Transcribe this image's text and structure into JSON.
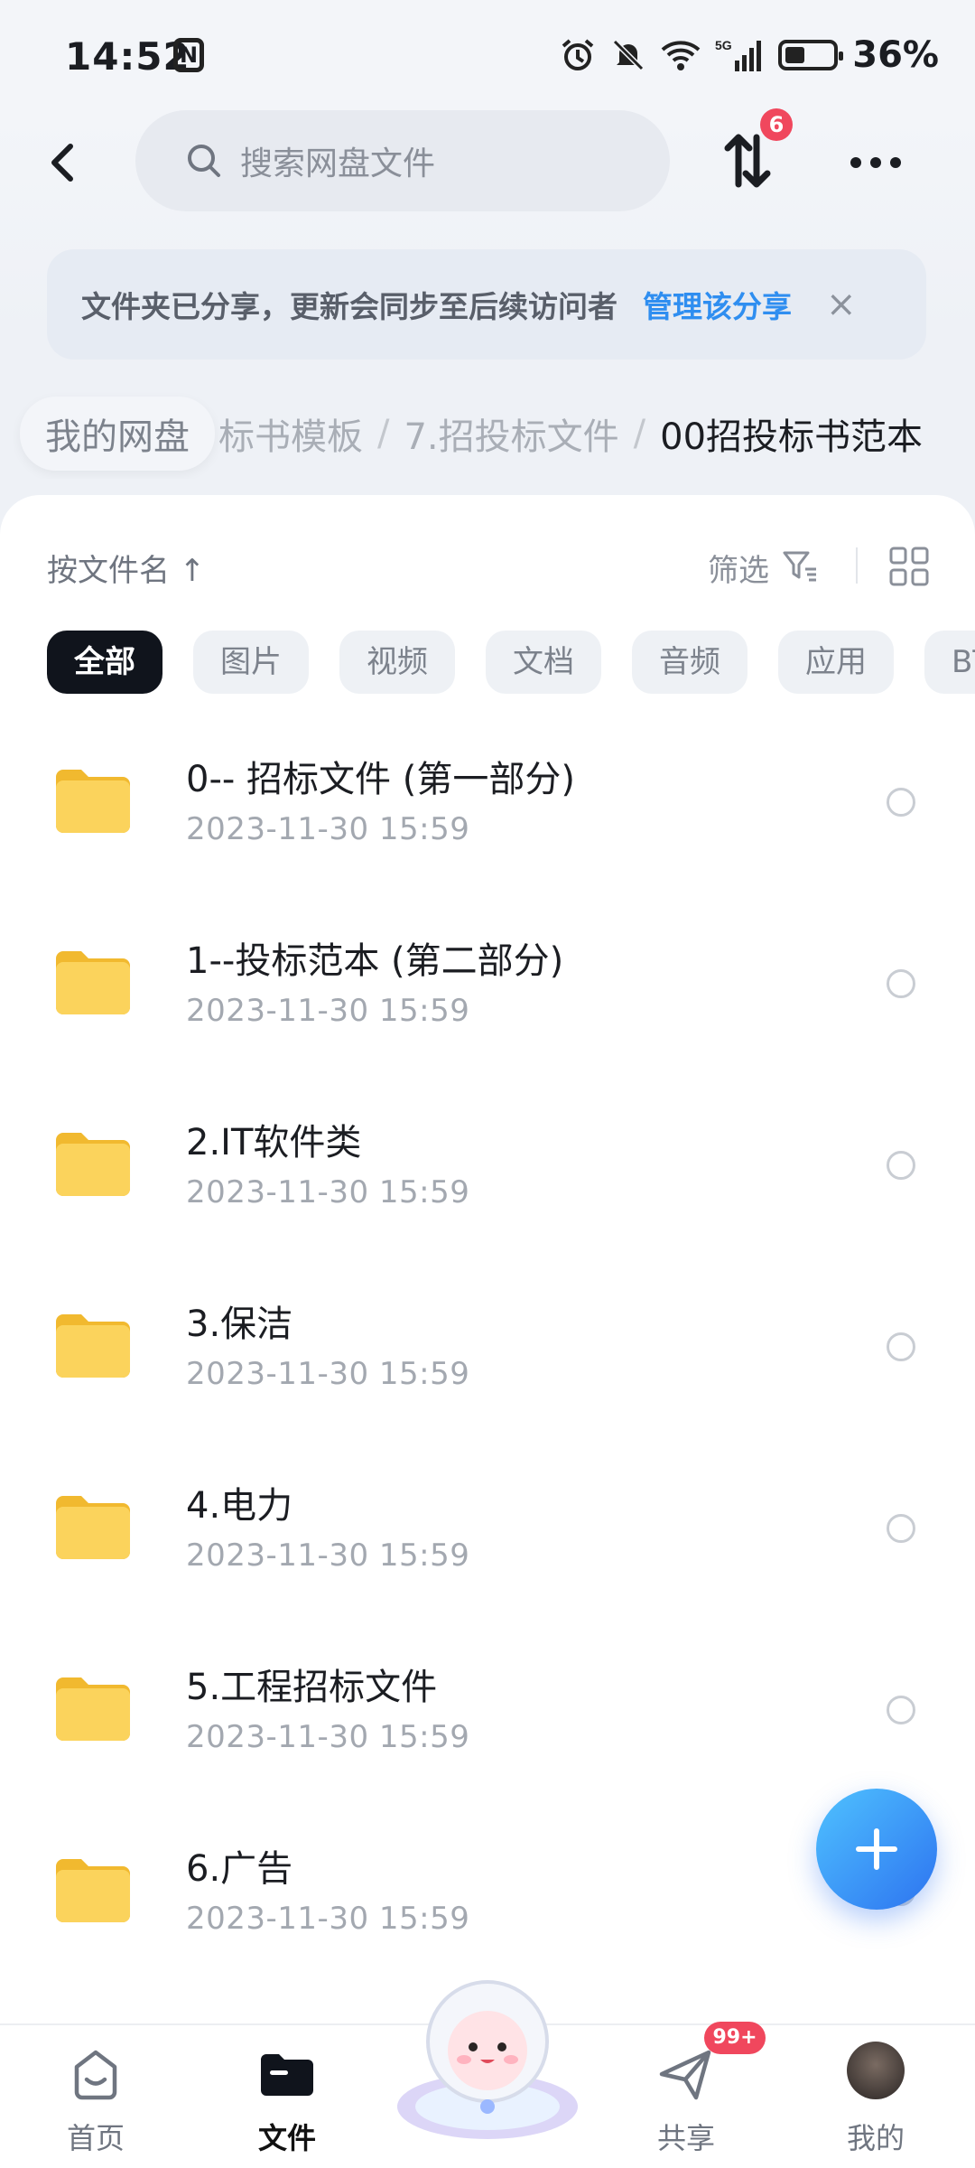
{
  "status_bar": {
    "time": "14:52",
    "network": "5G",
    "battery": "36%",
    "battery_level": 0.36
  },
  "header": {
    "search_placeholder": "搜索网盘文件",
    "transfer_badge": "6"
  },
  "banner": {
    "message": "文件夹已分享，更新会同步至后续访问者",
    "link": "管理该分享",
    "close": "×"
  },
  "breadcrumb": {
    "root": "我的网盘",
    "items": [
      "标书模板",
      "7.招投标文件"
    ],
    "current": "00招投标书范本",
    "separator": "/"
  },
  "toolbar": {
    "sort": "按文件名 ↑",
    "filter": "筛选"
  },
  "chips": [
    "全部",
    "图片",
    "视频",
    "文档",
    "音频",
    "应用",
    "BT"
  ],
  "files": [
    {
      "name": "0-- 招标文件 (第一部分)",
      "date": "2023-11-30  15:59"
    },
    {
      "name": "1--投标范本 (第二部分)",
      "date": "2023-11-30  15:59"
    },
    {
      "name": "2.IT软件类",
      "date": "2023-11-30  15:59"
    },
    {
      "name": "3.保洁",
      "date": "2023-11-30  15:59"
    },
    {
      "name": "4.电力",
      "date": "2023-11-30  15:59"
    },
    {
      "name": "5.工程招标文件",
      "date": "2023-11-30  15:59"
    },
    {
      "name": "6.广告",
      "date": "2023-11-30  15:59"
    }
  ],
  "nav": {
    "home": "首页",
    "files": "文件",
    "share": "共享",
    "share_badge": "99+",
    "me": "我的"
  },
  "colors": {
    "accent": "#2f8ef0",
    "badge": "#f0475d",
    "folder": "#f8c94a"
  }
}
